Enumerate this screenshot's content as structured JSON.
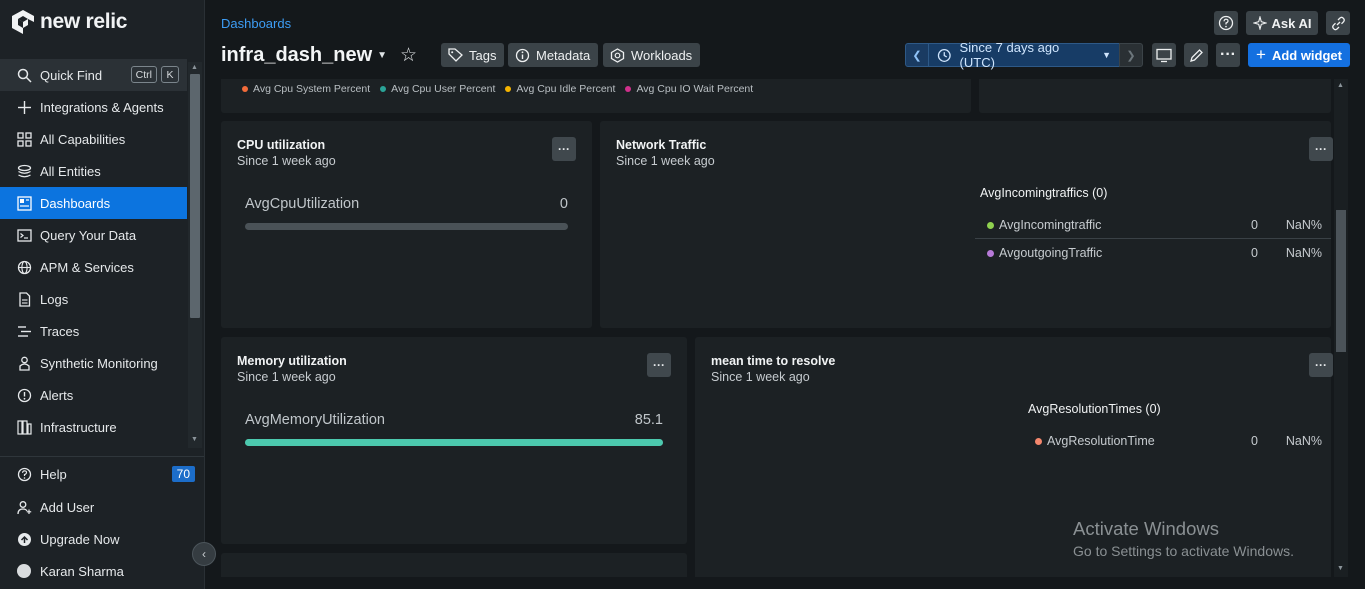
{
  "brand": {
    "name": "new relic"
  },
  "sidebar": {
    "items": [
      {
        "label": "Quick Find",
        "icon": "search-icon"
      },
      {
        "label": "Integrations & Agents",
        "icon": "plus-icon"
      },
      {
        "label": "All Capabilities",
        "icon": "grid-icon"
      },
      {
        "label": "All Entities",
        "icon": "layers-icon"
      },
      {
        "label": "Dashboards",
        "icon": "dashboard-icon",
        "active": true
      },
      {
        "label": "Query Your Data",
        "icon": "terminal-icon"
      },
      {
        "label": "APM & Services",
        "icon": "globe-icon"
      },
      {
        "label": "Logs",
        "icon": "document-icon"
      },
      {
        "label": "Traces",
        "icon": "traces-icon"
      },
      {
        "label": "Synthetic Monitoring",
        "icon": "robot-icon"
      },
      {
        "label": "Alerts",
        "icon": "alert-icon"
      },
      {
        "label": "Infrastructure",
        "icon": "server-icon"
      }
    ],
    "quick_find_keys": [
      "Ctrl",
      "K"
    ],
    "bottom": {
      "help": "Help",
      "help_badge": "70",
      "add_user": "Add User",
      "upgrade": "Upgrade Now",
      "user": "Karan Sharma"
    }
  },
  "header": {
    "breadcrumb": "Dashboards",
    "title": "infra_dash_new",
    "tags_label": "Tags",
    "metadata_label": "Metadata",
    "workloads_label": "Workloads",
    "time_range": "Since 7 days ago (UTC)",
    "ask_ai": "Ask AI",
    "add_widget": "Add widget"
  },
  "top_legend": [
    {
      "label": "Avg Cpu System Percent",
      "color": "#f26b3a"
    },
    {
      "label": "Avg Cpu User Percent",
      "color": "#2aa397"
    },
    {
      "label": "Avg Cpu Idle Percent",
      "color": "#f5b400"
    },
    {
      "label": "Avg Cpu IO Wait Percent",
      "color": "#d0308c"
    }
  ],
  "widgets": {
    "cpu": {
      "title": "CPU utilization",
      "subtitle": "Since 1 week ago",
      "metric": "AvgCpuUtilization",
      "value": "0",
      "fraction": 0
    },
    "network": {
      "title": "Network Traffic",
      "subtitle": "Since 1 week ago",
      "legend_title": "AvgIncomingtraffics (0)",
      "rows": [
        {
          "label": "AvgIncomingtraffic",
          "value": "0",
          "pct": "NaN%",
          "color": "#8fd14f"
        },
        {
          "label": "AvgoutgoingTraffic",
          "value": "0",
          "pct": "NaN%",
          "color": "#b77ad8"
        }
      ]
    },
    "memory": {
      "title": "Memory utilization",
      "subtitle": "Since 1 week ago",
      "metric": "AvgMemoryUtilization",
      "value": "85.1",
      "fraction": 1
    },
    "mttr": {
      "title": "mean time to resolve",
      "subtitle": "Since 1 week ago",
      "legend_title": "AvgResolutionTimes (0)",
      "rows": [
        {
          "label": "AvgResolutionTime",
          "value": "0",
          "pct": "NaN%",
          "color": "#f4876d"
        }
      ]
    }
  },
  "watermark": {
    "line1": "Activate Windows",
    "line2": "Go to Settings to activate Windows."
  }
}
